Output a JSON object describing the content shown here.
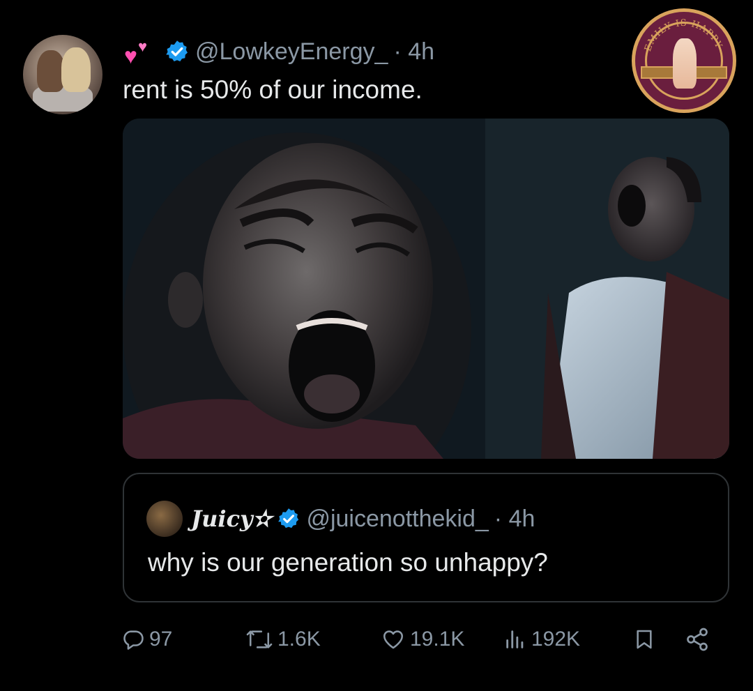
{
  "tweet": {
    "author_emoji": "💞",
    "handle": "@LowkeyEnergy_",
    "time": "· 4h",
    "text": "rent is 50% of our income."
  },
  "watermark": {
    "text": "EMILY IS HAPPY"
  },
  "quoted_tweet": {
    "display_name": "Juicy✫",
    "handle": "@juicenotthekid_",
    "time": "· 4h",
    "text": "why is our generation so unhappy?"
  },
  "actions": {
    "replies": "97",
    "reposts": "1.6K",
    "likes": "19.1K",
    "views": "192K"
  },
  "colors": {
    "background": "#000000",
    "text": "#e7e9ea",
    "muted": "#8b98a5",
    "verified": "#1d9bf0",
    "border": "#2f3336"
  }
}
